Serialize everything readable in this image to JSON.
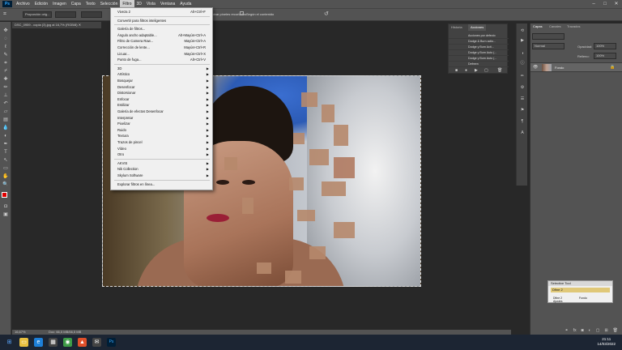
{
  "app": {
    "logo": "Ps"
  },
  "menubar": {
    "items": [
      "Archivo",
      "Edición",
      "Imagen",
      "Capa",
      "Texto",
      "Selección",
      "Filtro",
      "3D",
      "Vista",
      "Ventana",
      "Ayuda"
    ]
  },
  "options": {
    "proportion": "Proporción orig...",
    "delete_cropped": "Eliminar píxeles recortados",
    "content_aware": "Según el contenido"
  },
  "document": {
    "tab_title": "DSC_0959 - copia (3).jpg al 16,7% (RGB/8)",
    "zoom": "16,67%",
    "doc_info": "Doc: 66,5 MB/66,5 MB"
  },
  "filter_menu": {
    "last_filter": "Viveza 2",
    "last_filter_shortcut": "Alt+Ctrl+F",
    "smart_filters": "Convertir para filtros inteligentes",
    "group1": [
      {
        "label": "Galería de filtros...",
        "shortcut": ""
      },
      {
        "label": "Ángulo ancho adaptable...",
        "shortcut": "Alt+Mayús+Ctrl+A"
      },
      {
        "label": "Filtro de Camera Raw...",
        "shortcut": "Mayús+Ctrl+A"
      },
      {
        "label": "Corrección de lente...",
        "shortcut": "Mayús+Ctrl+R"
      },
      {
        "label": "Licuar...",
        "shortcut": "Mayús+Ctrl+X"
      },
      {
        "label": "Punto de fuga...",
        "shortcut": "Alt+Ctrl+V"
      }
    ],
    "group2": [
      "3D",
      "Artístico",
      "Bosquejar",
      "Desenfocar",
      "Distorsionar",
      "Enfocar",
      "Estilizar",
      "Galería de efectos Desenfocar",
      "Interpretar",
      "Pixelizar",
      "Ruido",
      "Textura",
      "Trazos de pincel",
      "Vídeo",
      "Otro"
    ],
    "group3": [
      "AKVIS",
      "Nik Collection",
      "Skylum Software"
    ],
    "browse": "Explorar filtros en línea..."
  },
  "actions_panel": {
    "tabs": [
      "Historia",
      "Acciones"
    ],
    "rows": [
      "Acciones por defecto",
      "Dodge & Burn actio...",
      "Dodge y Burn Acti...",
      "Dodge y Burn Auto (...",
      "Dodge y Burn Auto (...",
      "Defreen"
    ]
  },
  "layers_panel": {
    "tabs": [
      "Capas",
      "Canales",
      "Trazados"
    ],
    "kind_filter": "Normal",
    "opacity_label": "Opacidad:",
    "opacity_value": "100%",
    "fill_label": "Relleno:",
    "fill_value": "100%",
    "layer_name": "Fondo"
  },
  "selective_tool": {
    "title": "Selective Tool",
    "item": "Dfine 2",
    "sub": "Dfine 2",
    "fondo": "Fondo",
    "settings": "Ajustes"
  },
  "clock": {
    "time": "21:11",
    "date": "14/03/2022"
  }
}
